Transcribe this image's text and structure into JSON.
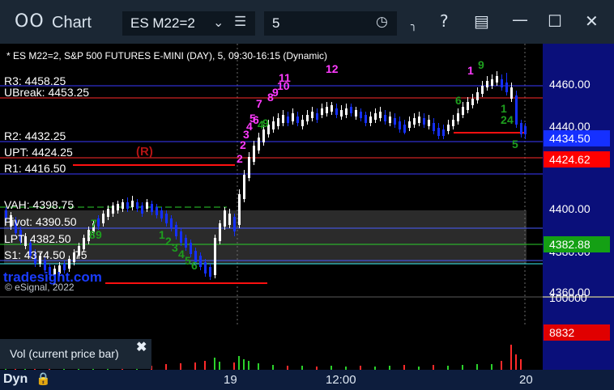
{
  "window": {
    "title": "Chart"
  },
  "toolbar": {
    "symbol": "ES M22=2",
    "interval": "5"
  },
  "chart": {
    "header": "* ES M22=2, S&P 500 FUTURES E-MINI (DAY), 5, 09:30-16:15 (Dynamic)",
    "levels": {
      "r3": "R3: 4458.25",
      "ubreak": "UBreak: 4453.25",
      "r2": "R2: 4432.25",
      "upt": "UPT: 4424.25",
      "r1": "R1: 4416.50",
      "vah": "VAH: 4398.75",
      "pivot": "Pivot: 4390.50",
      "lpt": "LPT: 4382.50",
      "s1": "S1: 4374.50",
      "s1_extra": "75"
    },
    "r_marker": "(R)",
    "brand": "tradesight.com",
    "copyright": "© eSignal, 2022",
    "axis_labels": [
      "4460.00",
      "4440.00",
      "4400.00",
      "4380.00",
      "4360.00",
      "100000"
    ],
    "price_tags": {
      "last": "4434.50",
      "upt_tag": "4424.62",
      "lpt_tag": "4382.88",
      "volume": "8832"
    },
    "seq_magenta": [
      "1",
      "2",
      "3",
      "4",
      "5",
      "6",
      "7",
      "8",
      "9",
      "10",
      "11",
      "12"
    ],
    "seq_green": [
      "1",
      "2",
      "3",
      "4",
      "5",
      "6",
      "7",
      "8",
      "9"
    ],
    "seq_right_magenta": "1",
    "seq_right_green": "9",
    "colors": {
      "up_candle": "#ffffff",
      "down_candle": "#1530ff",
      "resistance": "#ff2a2a",
      "support": "#2bd12b",
      "pivot": "#4a5cff",
      "last_price": "#1530ff",
      "upt_tag": "#ff0000",
      "lpt_tag": "#14a014"
    }
  },
  "volume_pane": {
    "label": "Vol (current price bar)"
  },
  "bottom": {
    "dyn_label": "Dyn",
    "times": [
      "19",
      "12:00",
      "20"
    ]
  }
}
